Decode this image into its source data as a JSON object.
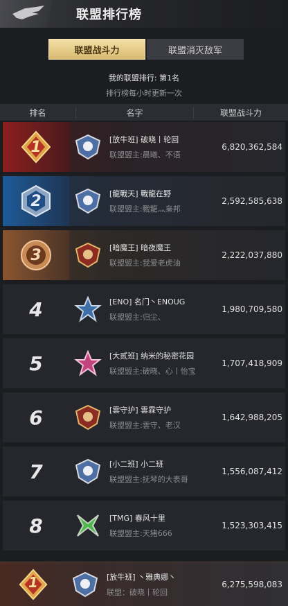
{
  "header": {
    "title": "联盟排行榜"
  },
  "tabs": [
    {
      "label": "联盟战斗力",
      "active": true
    },
    {
      "label": "联盟消灭敌军",
      "active": false
    }
  ],
  "info": {
    "my_rank": "我的联盟排行: 第1名",
    "update_note": "排行榜每小时更新一次"
  },
  "table": {
    "headers": {
      "rank": "排名",
      "name": "名字",
      "power": "联盟战斗力"
    },
    "rows": [
      {
        "rank": "1",
        "name": "[放牛班] 破晓丨轮回",
        "leader": "联盟盟主:晨曦、不语",
        "power": "6,820,362,584",
        "emblem": "blue-white-shield-emblem"
      },
      {
        "rank": "2",
        "name": "[龍戰天] 戰龍在野",
        "leader": "联盟盟主:戰龍灬枭邦",
        "power": "2,592,585,638",
        "emblem": "blue-white-shield-emblem"
      },
      {
        "rank": "3",
        "name": "[暗魔王] 暗夜魔王",
        "leader": "联盟盟主:我爱老虎油",
        "power": "2,222,037,880",
        "emblem": "red-gold-shield-emblem"
      },
      {
        "rank": "4",
        "name": "[ENO] 名门丶ENOUG",
        "leader": "联盟盟主:归尘、",
        "power": "1,980,709,580",
        "emblem": "blue-star-emblem"
      },
      {
        "rank": "5",
        "name": "[大贰班] 纳米的秘密花园",
        "leader": "联盟盟主:破晓、心丨怡宝",
        "power": "1,707,418,909",
        "emblem": "pink-star-emblem"
      },
      {
        "rank": "6",
        "name": "[雲守护] 雲霖守护",
        "leader": "联盟盟主:雲守、老汉",
        "power": "1,642,988,205",
        "emblem": "red-gold-shield-emblem"
      },
      {
        "rank": "7",
        "name": "[小二班] 小二班",
        "leader": "联盟盟主:抚琴的大表哥",
        "power": "1,556,087,412",
        "emblem": "blue-white-shield-emblem"
      },
      {
        "rank": "8",
        "name": "[TMG] 春风十里",
        "leader": "联盟盟主:天猪666",
        "power": "1,523,303,415",
        "emblem": "green-x-emblem"
      }
    ]
  },
  "footer": {
    "rank": "1",
    "name": "[放牛班] 丶雅典娜丶",
    "leader": "联盟：破晓丨轮回",
    "power": "6,275,598,083"
  },
  "colors": {
    "gold_accent": "#d9ba71",
    "rank1": "#8c1f20",
    "rank2": "#1d5a98",
    "rank3": "#8a5530"
  }
}
